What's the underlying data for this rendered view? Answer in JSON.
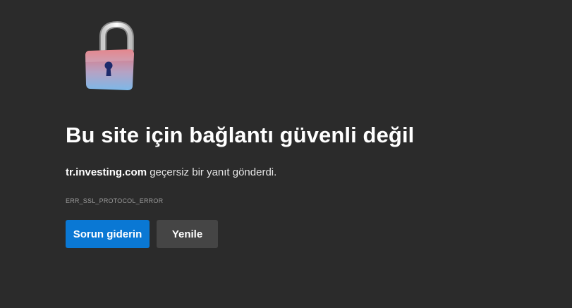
{
  "icon": "unlocked-padlock-icon",
  "error": {
    "title": "Bu site için bağlantı güvenli değil",
    "host": "tr.investing.com",
    "message": "geçersiz bir yanıt gönderdi.",
    "code": "ERR_SSL_PROTOCOL_ERROR"
  },
  "buttons": {
    "troubleshoot_label": "Sorun giderin",
    "reload_label": "Yenile"
  },
  "colors": {
    "background": "#2b2b2b",
    "primary_button": "#0a78d4",
    "secondary_button": "#454545"
  }
}
